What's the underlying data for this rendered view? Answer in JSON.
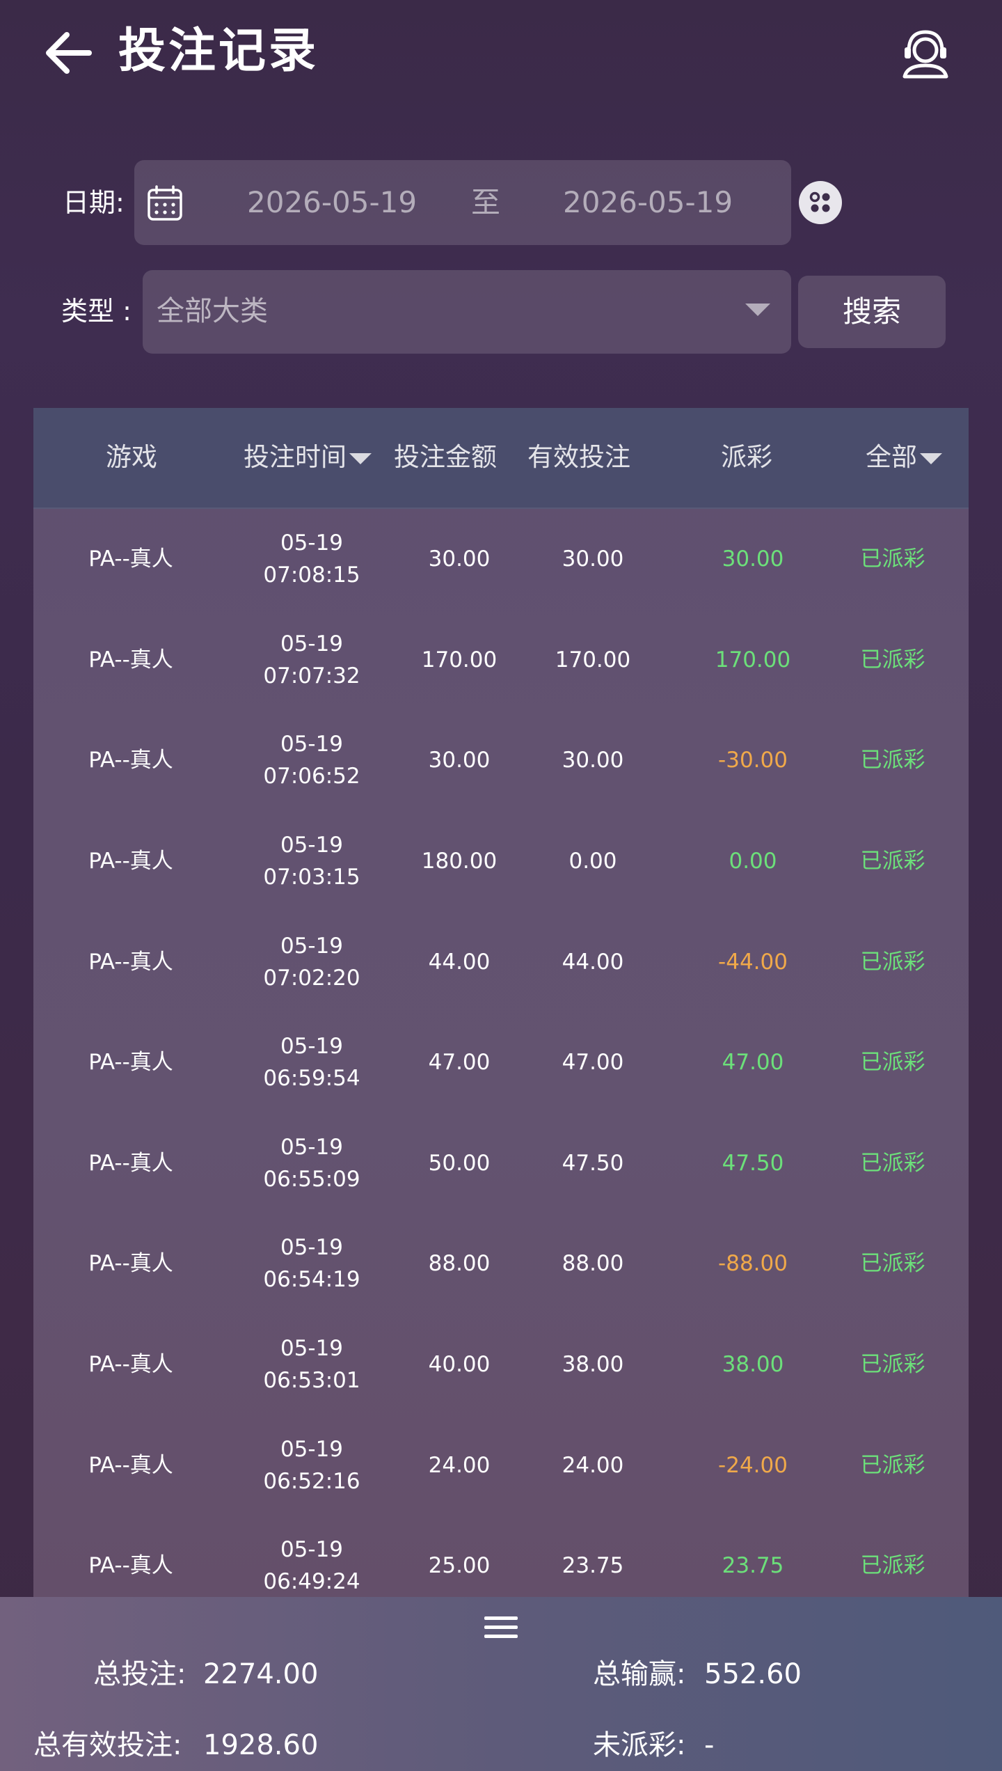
{
  "header": {
    "title": "投注记录",
    "back_icon": "arrow-left-icon",
    "support_icon": "customer-service-icon"
  },
  "filters": {
    "date_label": "日期:",
    "date_from": "2026-05-19",
    "date_separator": "至",
    "date_to": "2026-05-19",
    "type_label": "类型 :",
    "type_value": "全部大类",
    "search_label": "搜索"
  },
  "table": {
    "headers": {
      "game": "游戏",
      "time": "投注时间",
      "amount": "投注金额",
      "valid": "有效投注",
      "payout": "派彩",
      "status": "全部"
    },
    "rows": [
      {
        "game": "PA--真人",
        "date": "05-19",
        "time": "07:08:15",
        "amount": "30.00",
        "valid": "30.00",
        "payout": "30.00",
        "status": "已派彩"
      },
      {
        "game": "PA--真人",
        "date": "05-19",
        "time": "07:07:32",
        "amount": "170.00",
        "valid": "170.00",
        "payout": "170.00",
        "status": "已派彩"
      },
      {
        "game": "PA--真人",
        "date": "05-19",
        "time": "07:06:52",
        "amount": "30.00",
        "valid": "30.00",
        "payout": "-30.00",
        "status": "已派彩"
      },
      {
        "game": "PA--真人",
        "date": "05-19",
        "time": "07:03:15",
        "amount": "180.00",
        "valid": "0.00",
        "payout": "0.00",
        "status": "已派彩"
      },
      {
        "game": "PA--真人",
        "date": "05-19",
        "time": "07:02:20",
        "amount": "44.00",
        "valid": "44.00",
        "payout": "-44.00",
        "status": "已派彩"
      },
      {
        "game": "PA--真人",
        "date": "05-19",
        "time": "06:59:54",
        "amount": "47.00",
        "valid": "47.00",
        "payout": "47.00",
        "status": "已派彩"
      },
      {
        "game": "PA--真人",
        "date": "05-19",
        "time": "06:55:09",
        "amount": "50.00",
        "valid": "47.50",
        "payout": "47.50",
        "status": "已派彩"
      },
      {
        "game": "PA--真人",
        "date": "05-19",
        "time": "06:54:19",
        "amount": "88.00",
        "valid": "88.00",
        "payout": "-88.00",
        "status": "已派彩"
      },
      {
        "game": "PA--真人",
        "date": "05-19",
        "time": "06:53:01",
        "amount": "40.00",
        "valid": "38.00",
        "payout": "38.00",
        "status": "已派彩"
      },
      {
        "game": "PA--真人",
        "date": "05-19",
        "time": "06:52:16",
        "amount": "24.00",
        "valid": "24.00",
        "payout": "-24.00",
        "status": "已派彩"
      },
      {
        "game": "PA--真人",
        "date": "05-19",
        "time": "06:49:24",
        "amount": "25.00",
        "valid": "23.75",
        "payout": "23.75",
        "status": "已派彩"
      }
    ]
  },
  "summary": {
    "total_bet_label": "总投注:",
    "total_bet_value": "2274.00",
    "total_winloss_label": "总输赢:",
    "total_winloss_value": "552.60",
    "total_valid_label": "总有效投注:",
    "total_valid_value": "1928.60",
    "unsettled_label": "未派彩:",
    "unsettled_value": "-"
  },
  "colors": {
    "win": "#6ce07a",
    "loss": "#f0a94a",
    "status": "#6ce07a"
  }
}
